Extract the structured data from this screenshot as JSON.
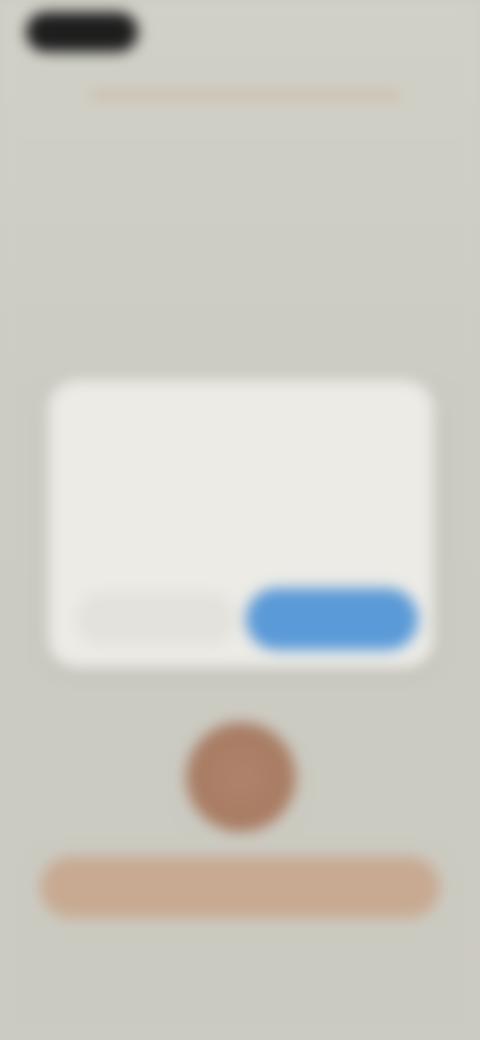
{
  "status_bar": {
    "time": "",
    "indicators": ""
  },
  "onboarding": {
    "progress_fraction": 1.0,
    "title": "",
    "caption": "",
    "primary_cta": ""
  },
  "dialog": {
    "title": "",
    "body": "",
    "cancel_label": "",
    "confirm_label": ""
  },
  "colors": {
    "background": "#cdccc3",
    "dialog_background": "#ecebe6",
    "confirm_button": "#5b9ad8",
    "primary_cta": "#c8aa92",
    "avatar": "#a87c63",
    "title_text": "#3d3a35",
    "status_pill": "#1e1e1e"
  },
  "icons": {
    "avatar": "person-avatar-icon"
  }
}
